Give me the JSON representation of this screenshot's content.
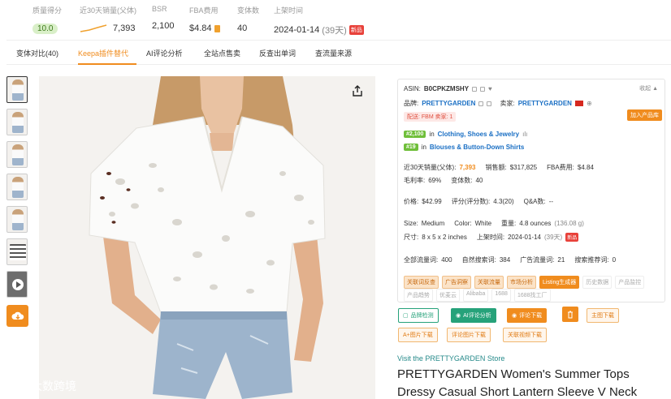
{
  "stats": {
    "quality_label": "质量得分",
    "quality_value": "10.0",
    "sales_label": "近30天销量(父体)",
    "sales_value": "7,393",
    "bsr_label": "BSR",
    "bsr_value": "2,100",
    "fba_label": "FBA费用",
    "fba_value": "$4.84",
    "variants_label": "变体数",
    "variants_value": "40",
    "launch_label": "上架时间",
    "launch_date": "2024-01-14",
    "launch_days": "(39天)",
    "new_tag": "新品"
  },
  "tabs": [
    {
      "label": "变体对比(40)"
    },
    {
      "label": "Keepa插件替代"
    },
    {
      "label": "AI评论分析"
    },
    {
      "label": "全站点售卖"
    },
    {
      "label": "反查出单词"
    },
    {
      "label": "查流量来源"
    }
  ],
  "panel": {
    "asin_label": "ASIN:",
    "asin": "B0CPKZMSHY",
    "collapse": "收起 ▲",
    "brand_label": "品牌:",
    "brand": "PRETTYGARDEN",
    "seller_label": "卖家:",
    "seller": "PRETTYGARDEN",
    "delivery_tag": "配送: FBM   卖家: 1",
    "add_product": "加入产品库",
    "rank1": "#2,100",
    "rank1_in": "in",
    "rank1_cat": "Clothing, Shoes & Jewelry",
    "rank2": "#19",
    "rank2_in": "in",
    "rank2_cat": "Blouses & Button-Down Shirts",
    "sales_label": "近30天销量(父体):",
    "sales": "7,393",
    "revenue_label": "销售额:",
    "revenue": "$317,825",
    "fba_label": "FBA费用:",
    "fba": "$4.84",
    "margin_label": "毛利率:",
    "margin": "69%",
    "variants_label": "变体数:",
    "variants": "40",
    "price_label": "价格:",
    "price": "$42.99",
    "rating_label": "评分(评分数):",
    "rating": "4.3(20)",
    "qa_label": "Q&A数:",
    "qa": "--",
    "size_label": "Size:",
    "size": "Medium",
    "color_label": "Color:",
    "color": "White",
    "weight_label": "重量:",
    "weight": "4.8 ounces",
    "weight_g": "(136.08 g)",
    "dims_label": "尺寸:",
    "dims": "8 x 5 x 2 inches",
    "launch_label": "上架时间:",
    "launch": "2024-01-14",
    "launch_days": "(39天)",
    "new_tag": "新品",
    "traffic_label": "全部流量词:",
    "traffic": "400",
    "organic_label": "自然搜索词:",
    "organic": "384",
    "ads_label": "广告流量词:",
    "ads": "21",
    "rec_label": "搜索推荐词:",
    "rec": "0",
    "chips1": [
      "关联词反查",
      "广告洞察",
      "关联流量",
      "市场分析",
      "Listing生成器",
      "历史数据",
      "产品监控"
    ],
    "chips2": [
      "产品趋势",
      "优麦云",
      "Alibaba",
      "1688",
      "1688找工厂"
    ]
  },
  "actions": {
    "btn1": "品牌检测",
    "btn2": "AI评论分析",
    "btn3": "评论下载",
    "btn5": "主图下载",
    "btn6": "A+图片下载",
    "btn7": "评论图片下载",
    "btn8": "关联视频下载"
  },
  "store_link": "Visit the PRETTYGARDEN Store",
  "product_title": "PRETTYGARDEN Women's Summer Tops Dressy Casual Short Lantern Sleeve V Neck",
  "watermark": "大数跨境",
  "colors": {
    "accent": "#f08c1e",
    "link": "#1a6fc4",
    "green": "#26a27a",
    "rank_green": "#6fbf3a"
  }
}
